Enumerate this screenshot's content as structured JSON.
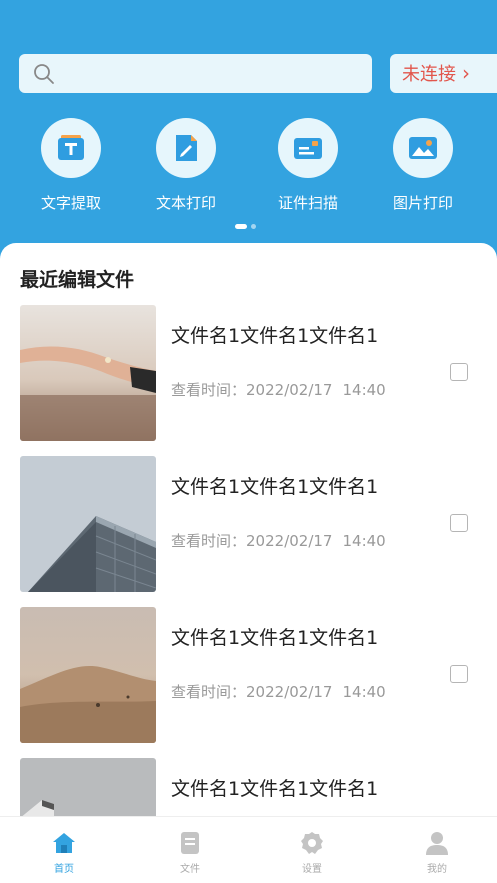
{
  "search": {
    "placeholder": ""
  },
  "connection": {
    "label": "未连接",
    "chevron": "›"
  },
  "features": [
    {
      "label": "文字提取",
      "icon": "text-extract-icon"
    },
    {
      "label": "文本打印",
      "icon": "text-print-icon"
    },
    {
      "label": "证件扫描",
      "icon": "id-scan-icon"
    },
    {
      "label": "图片打印",
      "icon": "image-print-icon"
    }
  ],
  "recent": {
    "title": "最近编辑文件",
    "items": [
      {
        "name": "文件名1文件名1文件名1",
        "time_label": "查看时间：",
        "date": "2022/02/17",
        "time": "14:40"
      },
      {
        "name": "文件名1文件名1文件名1",
        "time_label": "查看时间：",
        "date": "2022/02/17",
        "time": "14:40"
      },
      {
        "name": "文件名1文件名1文件名1",
        "time_label": "查看时间：",
        "date": "2022/02/17",
        "time": "14:40"
      },
      {
        "name": "文件名1文件名1文件名1",
        "time_label": "",
        "date": "",
        "time": ""
      }
    ]
  },
  "tabs": [
    {
      "label": "首页",
      "icon": "home-icon",
      "active": true
    },
    {
      "label": "文件",
      "icon": "file-icon",
      "active": false
    },
    {
      "label": "设置",
      "icon": "settings-icon",
      "active": false
    },
    {
      "label": "我的",
      "icon": "profile-icon",
      "active": false
    }
  ],
  "colors": {
    "primary": "#33a3e0",
    "accent_red": "#e2564c",
    "text": "#222222",
    "muted": "#999999"
  }
}
